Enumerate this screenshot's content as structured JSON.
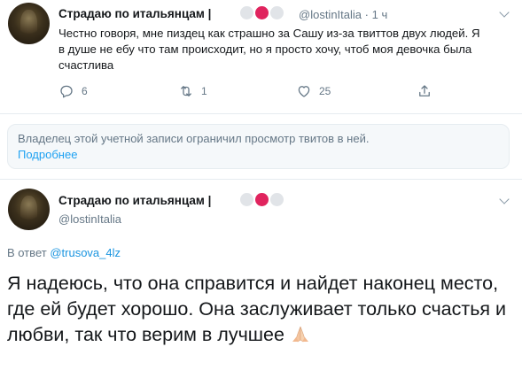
{
  "tweet1": {
    "author_name": "Страдаю по итальянцам |",
    "handle": "@lostinItalia",
    "separator": "·",
    "time": "1 ч",
    "text": "Честно говоря, мне пиздец как страшно за Сашу из-за твиттов двух людей. Я в душе не ебу что там происходит, но я просто хочу, чтоб моя девочка была счастлива",
    "replies": "6",
    "retweets": "1",
    "likes": "25",
    "icons": [
      "reply-icon",
      "retweet-icon",
      "like-icon",
      "share-icon"
    ]
  },
  "notice": {
    "text": "Владелец этой учетной записи ограничил просмотр твитов в ней.",
    "link": "Подробнее"
  },
  "tweet2": {
    "author_name": "Страдаю по итальянцам |",
    "handle": "@lostinItalia",
    "reply_prefix": "В ответ",
    "reply_to": "@trusova_4lz",
    "text": "Я надеюсь, что она справится и найдет наконец место, где ей будет хорошо. Она заслуживает только счастья и любви, так что верим в лучшее",
    "emoji": "folded-hands-icon"
  },
  "colors": {
    "accent": "#1da1f2",
    "secondary_text": "#657786",
    "dot_red": "#e0245e",
    "dot_gray": "#e1e4e8"
  }
}
